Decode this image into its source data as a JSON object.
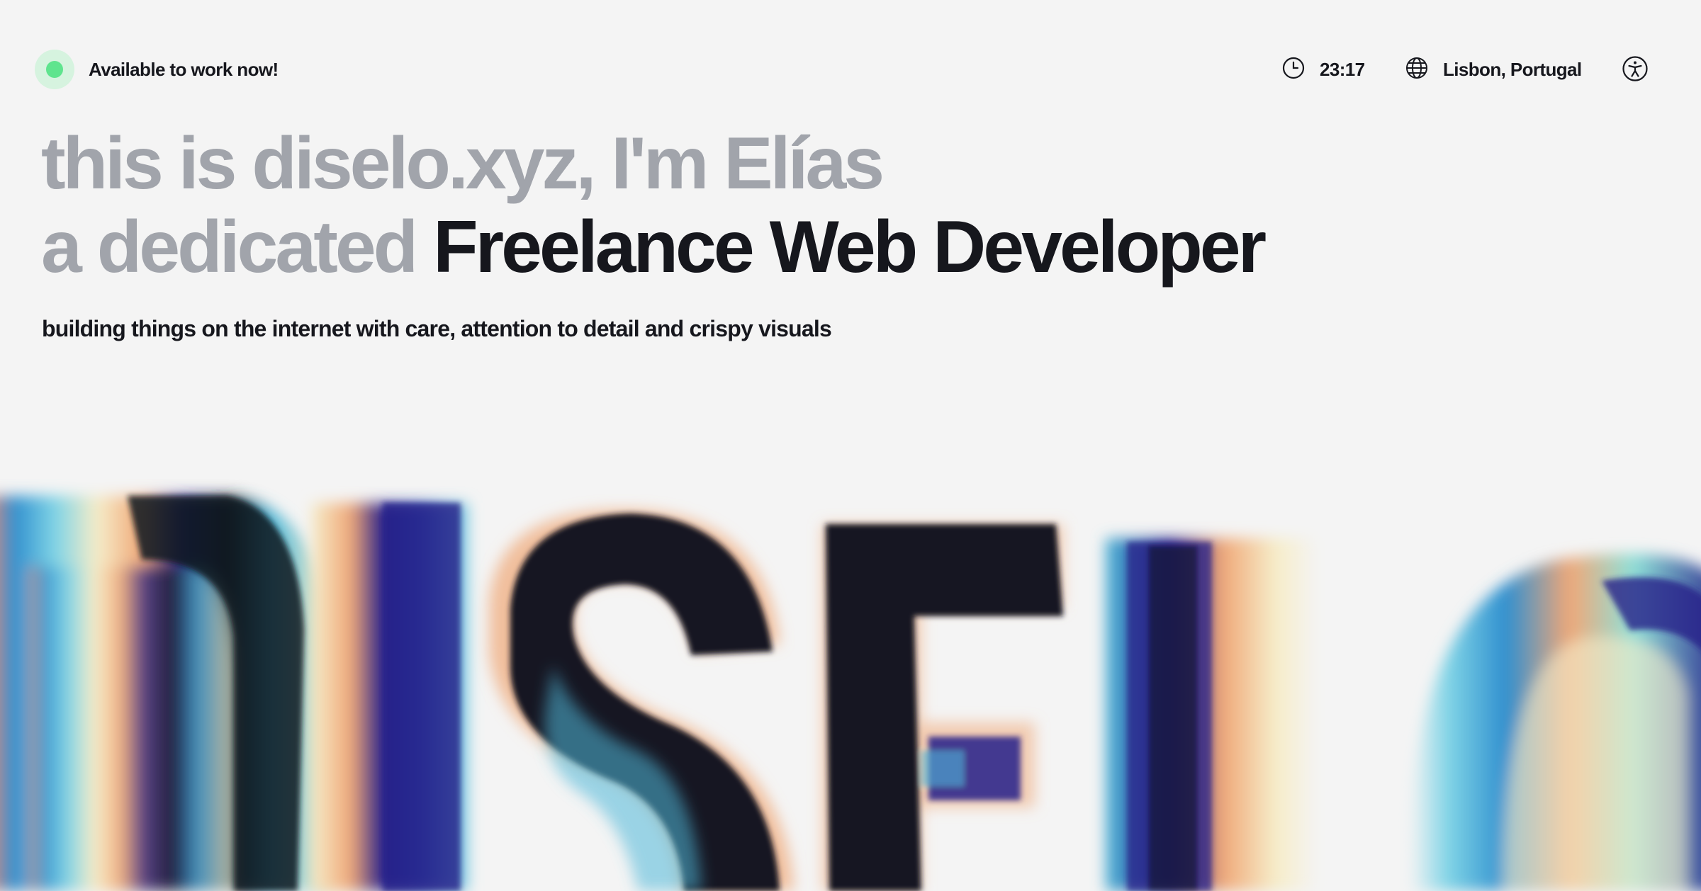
{
  "header": {
    "availability": "Available to work now!",
    "time": "23:17",
    "location": "Lisbon, Portugal",
    "icons": {
      "status": "status-dot-icon",
      "clock": "clock-icon",
      "location": "globe-icon",
      "accessibility": "accessibility-icon"
    }
  },
  "hero": {
    "line1": "this is diselo.xyz, I'm Elías",
    "line2_muted": "a dedicated",
    "line2_strong": "Freelance Web Developer",
    "tagline": "building things on the internet with care, attention to detail and crispy visuals"
  },
  "art": {
    "text": "DISELO"
  },
  "colors": {
    "background": "#f4f4f4",
    "text": "#16171d",
    "muted": "#a1a4ab",
    "status_dot": "#5fe48e",
    "status_halo": "#d6f3df",
    "art_dark": "#131722",
    "art_blue": "#4fb8d9",
    "art_indigo": "#25208a",
    "art_cream": "#f6edc9",
    "art_peach": "#f0a878"
  }
}
